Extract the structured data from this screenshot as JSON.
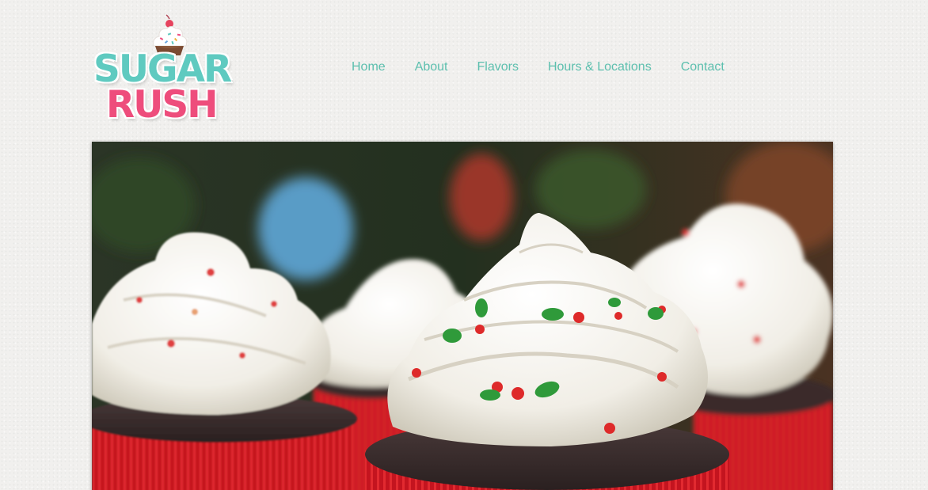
{
  "brand": {
    "line1": "SUGAR",
    "line2": "RUSH",
    "colors": {
      "teal": "#5fcac0",
      "pink": "#ee4d7c"
    }
  },
  "nav": {
    "items": [
      {
        "label": "Home"
      },
      {
        "label": "About"
      },
      {
        "label": "Flavors"
      },
      {
        "label": "Hours & Locations"
      },
      {
        "label": "Contact"
      }
    ],
    "color": "#5cbfae"
  },
  "hero": {
    "subject": "frosted-cupcakes-with-sprinkles"
  }
}
